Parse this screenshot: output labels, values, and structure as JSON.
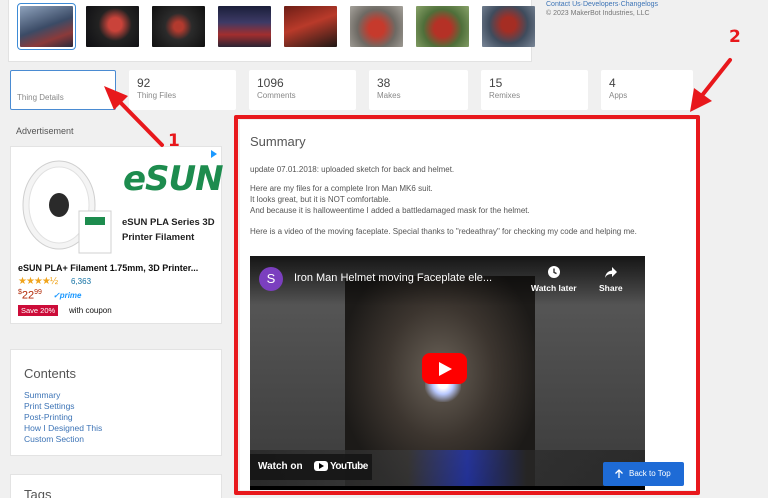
{
  "gallery": {
    "thumbnails": [
      "thumb-1",
      "thumb-2",
      "thumb-3",
      "thumb-4",
      "thumb-5",
      "thumb-6",
      "thumb-7",
      "thumb-8"
    ]
  },
  "footer_links": {
    "line1": "Contact Us·Developers·Changelogs",
    "copyright": "© 2023 MakerBot Industries, LLC"
  },
  "stats": {
    "details_label": "Thing Details",
    "files": {
      "count": "92",
      "label": "Thing Files"
    },
    "comments": {
      "count": "1096",
      "label": "Comments"
    },
    "makes": {
      "count": "38",
      "label": "Makes"
    },
    "remixes": {
      "count": "15",
      "label": "Remixes"
    },
    "apps": {
      "count": "4",
      "label": "Apps"
    }
  },
  "ad": {
    "label": "Advertisement",
    "brand": "eSUN",
    "title": "eSUN PLA Series 3D Printer Filament",
    "product": "eSUN PLA+ Filament 1.75mm, 3D Printer...",
    "stars": "★★★★½",
    "reviews": "6,363",
    "price_dollar": "$",
    "price_whole": "22",
    "price_cents": "99",
    "prime": "✓prime",
    "save_badge": "Save 20%",
    "coupon": "with coupon"
  },
  "contents": {
    "heading": "Contents",
    "items": [
      "Summary",
      "Print Settings",
      "Post-Printing",
      "How I Designed This",
      "Custom Section"
    ]
  },
  "tags": {
    "heading": "Tags"
  },
  "summary": {
    "heading": "Summary",
    "p1": "update 07.01.2018: uploaded sketch for back and helmet.",
    "p2_l1": "Here are my files for a complete Iron Man MK6 suit.",
    "p2_l2": "It looks great, but it is NOT comfortable.",
    "p2_l3": "And because it is halloweentime I added a battledamaged mask for the helmet.",
    "p3": "Here is a video of the moving faceplate. Special thanks to \"redeathray\" for checking my code and helping me."
  },
  "video": {
    "channel_initial": "S",
    "title": "Iron Man Helmet moving Faceplate ele...",
    "watch_later": "Watch later",
    "share": "Share",
    "watch_on": "Watch on",
    "youtube": "YouTube"
  },
  "back_to_top": "Back to Top",
  "annotations": {
    "one": "1",
    "two": "2"
  },
  "colors": {
    "accent": "#1e6bd6",
    "annotation": "#e8181c",
    "link": "#3d74b6"
  }
}
